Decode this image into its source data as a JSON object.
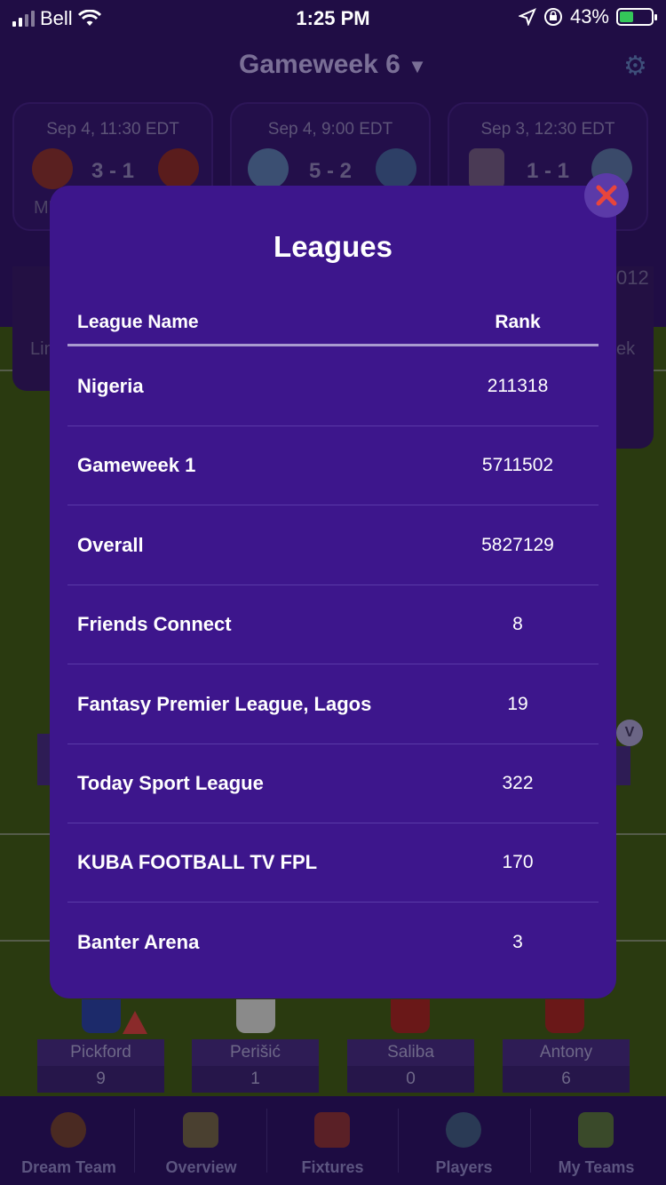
{
  "status_bar": {
    "carrier": "Bell",
    "time": "1:25 PM",
    "battery": "43%",
    "battery_level": 0.43
  },
  "header": {
    "title": "Gameweek 6"
  },
  "fixtures": [
    {
      "date": "Sep 4, 11:30 EDT",
      "score": "3 - 1",
      "home_label": "MU"
    },
    {
      "date": "Sep 4, 9:00 EDT",
      "score": "5 - 2"
    },
    {
      "date": "Sep 3, 12:30 EDT",
      "score": "1 - 1"
    }
  ],
  "background_fragments": {
    "right_number": "012",
    "left_text": "Lin",
    "right_text": "ek",
    "badge": "V"
  },
  "players": [
    {
      "name": "Pickford",
      "points": "9"
    },
    {
      "name": "Perišić",
      "points": "1"
    },
    {
      "name": "Saliba",
      "points": "0"
    },
    {
      "name": "Antony",
      "points": "6"
    }
  ],
  "bottom_nav": [
    {
      "label": "Dream Team",
      "icon": "medal-icon"
    },
    {
      "label": "Overview",
      "icon": "tactics-board-icon"
    },
    {
      "label": "Fixtures",
      "icon": "calendar-ball-icon"
    },
    {
      "label": "Players",
      "icon": "player-search-icon"
    },
    {
      "label": "My Teams",
      "icon": "fc-shield-icon"
    }
  ],
  "modal": {
    "title": "Leagues",
    "columns": {
      "name": "League Name",
      "rank": "Rank"
    },
    "rows": [
      {
        "name": "Nigeria",
        "rank": "211318"
      },
      {
        "name": "Gameweek 1",
        "rank": "5711502"
      },
      {
        "name": "Overall",
        "rank": "5827129"
      },
      {
        "name": "Friends Connect",
        "rank": "8"
      },
      {
        "name": "Fantasy Premier League, Lagos",
        "rank": "19"
      },
      {
        "name": "Today Sport League",
        "rank": "322"
      },
      {
        "name": "KUBA FOOTBALL TV FPL",
        "rank": "170"
      },
      {
        "name": "Banter Arena",
        "rank": "3"
      }
    ]
  },
  "colors": {
    "modal_bg": "#3d168c",
    "close_x": "#e8453c",
    "accent": "#34c759"
  }
}
